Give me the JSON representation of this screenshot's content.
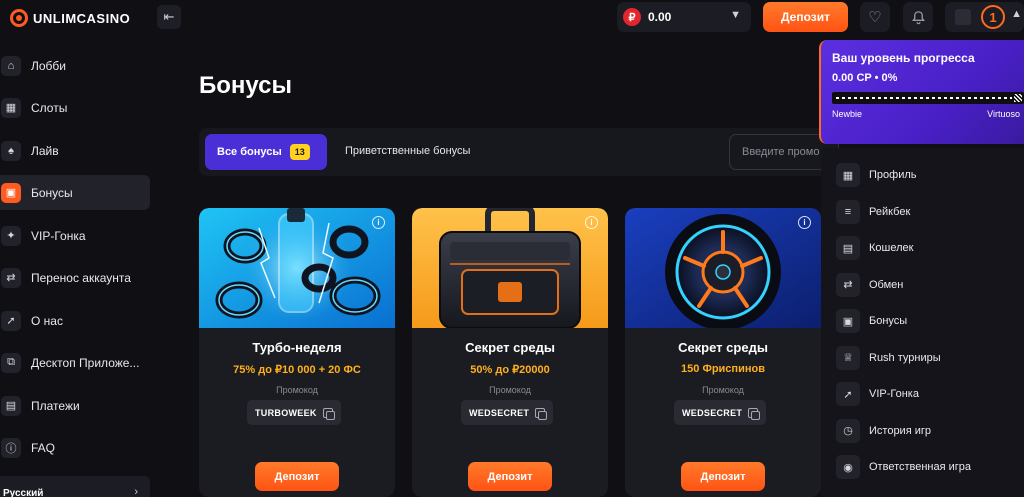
{
  "app": {
    "logo_text": "unlimcasino"
  },
  "topbar": {
    "currency_symbol": "₽",
    "balance": "0.00",
    "deposit_label": "Депозит",
    "level": "1"
  },
  "sidebar": {
    "items": [
      {
        "label": "Лобби",
        "icon": "home-icon"
      },
      {
        "label": "Слоты",
        "icon": "grid-icon"
      },
      {
        "label": "Лайв",
        "icon": "spade-icon"
      },
      {
        "label": "Бонусы",
        "icon": "ticket-icon"
      },
      {
        "label": "VIP-Гонка",
        "icon": "sparkle-icon"
      },
      {
        "label": "Перенос аккаунта",
        "icon": "transfer-icon"
      },
      {
        "label": "О нас",
        "icon": "rocket-icon"
      },
      {
        "label": "Десктоп Приложе...",
        "icon": "external-link-icon"
      },
      {
        "label": "Платежи",
        "icon": "wallet-icon"
      },
      {
        "label": "FAQ",
        "icon": "info-icon"
      }
    ],
    "language": "Русский"
  },
  "main": {
    "title": "Бонусы",
    "tabs": [
      {
        "label": "Все бонусы",
        "count": "13"
      },
      {
        "label": "Приветственные бонусы"
      }
    ],
    "search_placeholder": "Введите промо"
  },
  "cards": [
    {
      "title": "Турбо-неделя",
      "offer": "75% до ₽10 000 + 20 ФС",
      "promo_label": "Промокод",
      "promo_code": "TURBOWEEK",
      "deposit_label": "Депозит",
      "theme": "#2bb6f0"
    },
    {
      "title": "Секрет среды",
      "offer": "50% до ₽20000",
      "promo_label": "Промокод",
      "promo_code": "WEDSECRET",
      "deposit_label": "Депозит",
      "theme": "#f5a623"
    },
    {
      "title": "Секрет среды",
      "offer": "150 Фриспинов",
      "promo_label": "Промокод",
      "promo_code": "WEDSECRET",
      "deposit_label": "Депозит",
      "theme": "#1d4fd0"
    }
  ],
  "progress": {
    "title": "Ваш уровень прогресса",
    "stats": "0.00 CP • 0%",
    "percent": 0,
    "start_level": "Newbie",
    "end_level": "Virtuoso"
  },
  "user_menu": {
    "items": [
      {
        "label": "Профиль",
        "icon": "grid-icon"
      },
      {
        "label": "Рейкбек",
        "icon": "coins-icon"
      },
      {
        "label": "Кошелек",
        "icon": "wallet-icon"
      },
      {
        "label": "Обмен",
        "icon": "transfer-icon"
      },
      {
        "label": "Бонусы",
        "icon": "ticket-icon"
      },
      {
        "label": "Rush турниры",
        "icon": "trophy-icon"
      },
      {
        "label": "VIP-Гонка",
        "icon": "rocket-icon"
      },
      {
        "label": "История игр",
        "icon": "clock-icon"
      },
      {
        "label": "Ответственная игра",
        "icon": "eye-icon"
      }
    ]
  },
  "colors": {
    "accent": "#ff5a1f",
    "tab_active": "#4a2fd6",
    "offer": "#ffb01f",
    "background": "#0f0f14"
  }
}
